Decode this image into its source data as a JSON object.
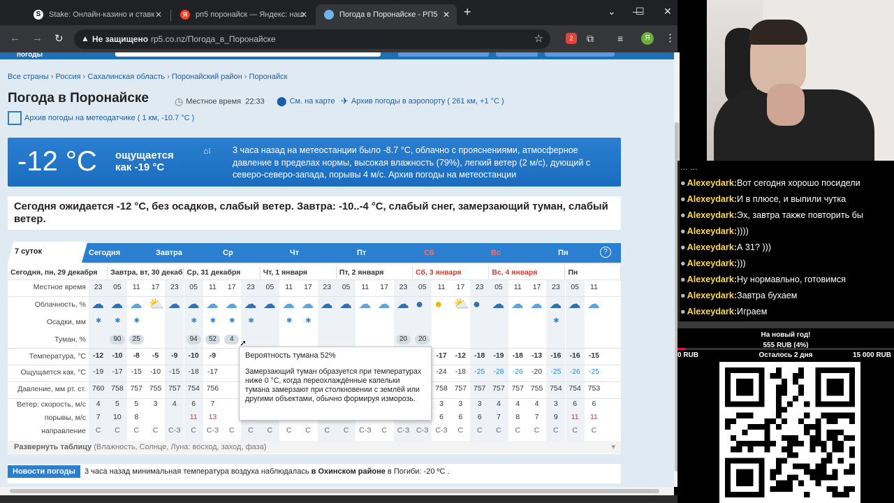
{
  "browser": {
    "tabs": [
      {
        "title": "Stake: Онлайн-казино и ставк",
        "active": false
      },
      {
        "title": "рп5 поронайск — Яндекс: наш",
        "active": false
      },
      {
        "title": "Погода в Поронайске - РП5",
        "active": true
      }
    ],
    "new_tab": "+",
    "security": "Не защищено",
    "url": "rp5.co.nz/Погода_в_Поронайске",
    "profile_initial": "Я",
    "ext_badge": "2"
  },
  "site": {
    "logo_text": "погоды",
    "breadcrumb": [
      "Все страны",
      "Россия",
      "Сахалинская область",
      "Поронайский район",
      "Поронайск"
    ],
    "title": "Погода в Поронайске",
    "local_time_label": "Местное время",
    "local_time": "22:33",
    "map_link": "См. на карте",
    "airport_link": "Архив погоды в аэропорту ( 261 км, +1 °C )",
    "meteo_link": "Архив погоды на метеодатчике ( 1 км, -10.7 °C )"
  },
  "current": {
    "temp": "-12 °C",
    "feels_1": "ощущается",
    "feels_2": "как -19 °C",
    "text": "3 часа назад на метеостанции было -8.7 °C, облачно с прояснениями, атмосферное давление в пределах нормы, высокая влажность (79%), легкий ветер (2 м/с), дующий с северо-северо-запада, порывы 4 м/с. Архив погоды на метеостанции"
  },
  "forecast_summary": "Сегодня ожидается -12 °C, без осадков, слабый ветер. Завтра: -10..-4 °C, слабый снег, замерзающий туман, слабый ветер.",
  "day_tabs": [
    {
      "label": "7 суток",
      "selected": true,
      "weekend": false
    },
    {
      "label": "Сегодня",
      "selected": false,
      "weekend": false
    },
    {
      "label": "Завтра",
      "selected": false,
      "weekend": false
    },
    {
      "label": "Ср",
      "selected": false,
      "weekend": false
    },
    {
      "label": "Чт",
      "selected": false,
      "weekend": false
    },
    {
      "label": "Пт",
      "selected": false,
      "weekend": false
    },
    {
      "label": "Сб",
      "selected": false,
      "weekend": true
    },
    {
      "label": "Вс",
      "selected": false,
      "weekend": true
    },
    {
      "label": "Пн",
      "selected": false,
      "weekend": false
    }
  ],
  "help": "?",
  "table": {
    "day_headers": [
      {
        "label": "Сегодня, пн, 29 декабря",
        "weekend": false
      },
      {
        "label": "Завтра, вт, 30 декабря",
        "weekend": false
      },
      {
        "label": "Ср, 31 декабря",
        "weekend": false
      },
      {
        "label": "Чт, 1 января",
        "weekend": false
      },
      {
        "label": "Пт, 2 января",
        "weekend": false
      },
      {
        "label": "Сб, 3 января",
        "weekend": true
      },
      {
        "label": "Вс, 4 января",
        "weekend": true
      },
      {
        "label": "Пн",
        "weekend": false
      }
    ],
    "row_labels": {
      "time": "Местное время",
      "cloud": "Облачность, %",
      "precip": "Осадки, мм",
      "fog": "Туман, %",
      "temp": "Температура, °C",
      "feels": "Ощущается как, °C",
      "pressure": "Давление, мм рт. ст.",
      "wind": "Ветер: скорость, м/с",
      "gusts": "порывы, м/с",
      "dir": "направление"
    },
    "times": [
      "23",
      "05",
      "11",
      "17",
      "23",
      "05",
      "11",
      "17",
      "23",
      "05",
      "11",
      "17",
      "23",
      "05",
      "11",
      "17",
      "23",
      "05",
      "11",
      "17",
      "23",
      "05",
      "11",
      "17",
      "23",
      "05",
      "11"
    ],
    "cloud_icons": [
      "snow-cloud",
      "snow-cloud",
      "cloud",
      "sun-cloud",
      "snow-cloud",
      "snow-cloud",
      "cloud",
      "cloud",
      "snow-cloud",
      "snow-cloud",
      "cloud",
      "cloud",
      "snow-cloud",
      "snow-cloud",
      "cloud",
      "cloud",
      "night-cloud",
      "night",
      "sun",
      "sun-cloud",
      "night",
      "snow-cloud",
      "cloud",
      "cloud",
      "snow-cloud",
      "snow-cloud",
      "cloud"
    ],
    "snow": [
      1,
      1,
      1,
      0,
      0,
      1,
      1,
      1,
      1,
      0,
      1,
      1,
      0,
      0,
      0,
      0,
      0,
      0,
      0,
      0,
      0,
      0,
      0,
      0,
      1,
      0,
      0
    ],
    "fog": [
      "",
      "90",
      "25",
      "",
      "",
      "94",
      "52",
      "4",
      "",
      "",
      "",
      "",
      "",
      "",
      "",
      "",
      "20",
      "20",
      "",
      "",
      "",
      "",
      "",
      "",
      "",
      "",
      ""
    ],
    "temp": [
      "-12",
      "-10",
      "-8",
      "-5",
      "-9",
      "-10",
      "-9",
      "",
      "",
      "",
      "",
      "",
      "",
      "",
      "",
      "",
      "",
      "-18",
      "-17",
      "-12",
      "-18",
      "-19",
      "-18",
      "-13",
      "-16",
      "-16",
      "-15"
    ],
    "feels": [
      "-19",
      "-17",
      "-15",
      "-10",
      "-15",
      "-18",
      "-17",
      "",
      "",
      "",
      "",
      "",
      "",
      "",
      "",
      "",
      "",
      "-26",
      "-24",
      "-18",
      "-25",
      "-28",
      "-26",
      "-20",
      "-25",
      "-26",
      "-25"
    ],
    "pressure": [
      "760",
      "758",
      "757",
      "755",
      "757",
      "754",
      "756",
      "",
      "",
      "",
      "",
      "",
      "",
      "",
      "",
      "",
      "",
      "758",
      "758",
      "757",
      "757",
      "757",
      "757",
      "755",
      "754",
      "754",
      "753"
    ],
    "wind": [
      "4",
      "5",
      "5",
      "3",
      "4",
      "6",
      "7",
      "",
      "",
      "",
      "",
      "",
      "",
      "",
      "",
      "",
      "",
      "4",
      "3",
      "3",
      "3",
      "4",
      "4",
      "4",
      "3",
      "6",
      "6"
    ],
    "gusts": [
      "7",
      "10",
      "8",
      "",
      "",
      "11",
      "13",
      "",
      "",
      "",
      "",
      "",
      "",
      "",
      "",
      "",
      "",
      "",
      "6",
      "6",
      "6",
      "7",
      "8",
      "7",
      "9",
      "11",
      "11"
    ],
    "dir": [
      "С",
      "С",
      "С",
      "С",
      "С-З",
      "С",
      "С-З",
      "С",
      "С",
      "С",
      "С",
      "С",
      "С",
      "С",
      "С-З",
      "С",
      "С-З",
      "С-З",
      "С-З",
      "С",
      "С",
      "С",
      "С",
      "С",
      "С",
      "С",
      "С"
    ],
    "expand_label": "Развернуть таблицу",
    "expand_hint": "(Влажность, Солнце, Луна: восход, заход, фаза)"
  },
  "tooltip": {
    "title": "Вероятность тумана 52%",
    "body": "Замерзающий туман образуется при температурах ниже 0 °C, когда переохлаждённые капельки тумана замерзают при столкновении с землёй или другими объектами, обычно формируя изморозь."
  },
  "news": {
    "label": "Новости погоды",
    "text_pre": "3 часа назад минимальная температура воздуха наблюдалась ",
    "text_bold": "в Охинском районе",
    "text_post": " в Погиби: -20 ºC ."
  },
  "chat": {
    "partial_top": "... ...",
    "messages": [
      {
        "nick": "Alexeydark",
        "text": "Вот сегодня хорошо посидели"
      },
      {
        "nick": "Alexeydark",
        "text": "И в плюсе, и выпили чутка"
      },
      {
        "nick": "Alexeydark",
        "text": "Эх, завтра также повторить бы"
      },
      {
        "nick": "Alexeydark",
        "text": "))))"
      },
      {
        "nick": "Alexeydark",
        "text": "А 31? )))"
      },
      {
        "nick": "Alexeydark",
        "text": ")))"
      },
      {
        "nick": "Alexeydark",
        "text": "Ну нормавльно, готовимся"
      },
      {
        "nick": "Alexeydark",
        "text": "Завтра бухаем"
      },
      {
        "nick": "Alexeydark",
        "text": "Играем"
      }
    ]
  },
  "donation": {
    "goal": "На новый год!",
    "sum": "555 RUB (4%)",
    "min": "0 RUB",
    "remaining": "Осталось 2 дня",
    "max": "15 000 RUB",
    "progress": 0.04
  },
  "colors": {
    "brand_blue": "#2a7fd0",
    "weekend_red": "#d63a2d",
    "chat_nick": "#ffd94a",
    "donation_bar": "#d4145a"
  }
}
